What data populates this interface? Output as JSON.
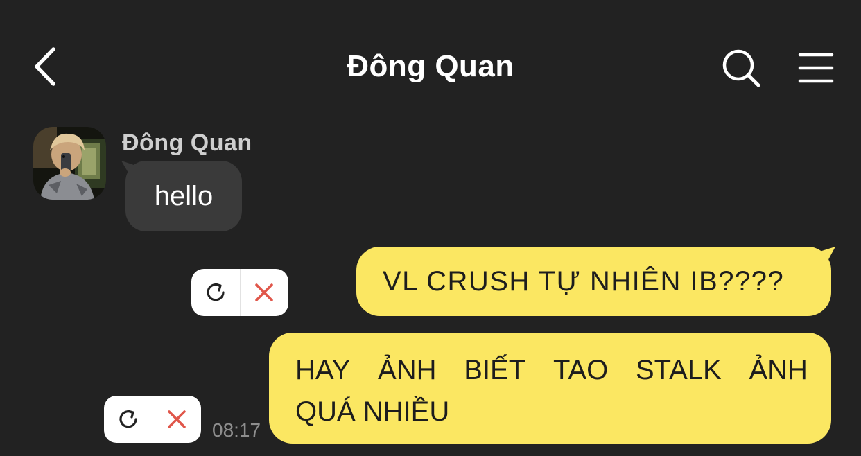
{
  "header": {
    "title": "Đông Quan",
    "icons": [
      "chevron-left-icon",
      "search-icon",
      "hamburger-menu-icon"
    ]
  },
  "conversation": {
    "incoming": {
      "sender_name": "Đông Quan",
      "text": "hello"
    },
    "outgoing": [
      {
        "text": "VL CRUSH TỰ NHIÊN IB????",
        "status": "failed"
      },
      {
        "lines": [
          "HAY ẢNH BIẾT TAO STALK ẢNH",
          "QUÁ NHIỀU"
        ],
        "status": "failed",
        "time": "08:17"
      }
    ]
  },
  "colors": {
    "background": "#222222",
    "incoming_bubble": "#3a3a3a",
    "outgoing_bubble": "#fbe762",
    "outgoing_text": "#1d1d1d",
    "delete_icon": "#e0564a",
    "timestamp": "#8e8e8e"
  }
}
